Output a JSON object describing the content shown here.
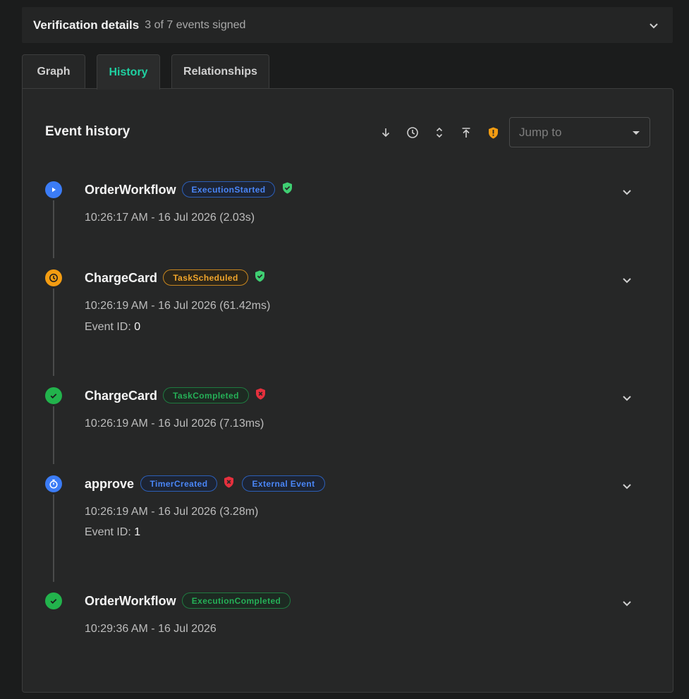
{
  "verification": {
    "title": "Verification details",
    "subtitle": "3 of 7 events signed"
  },
  "tabs": [
    {
      "label": "Graph",
      "active": false
    },
    {
      "label": "History",
      "active": true
    },
    {
      "label": "Relationships",
      "active": false
    }
  ],
  "panel": {
    "title": "Event history",
    "toolbar": [
      "sort-descending-icon",
      "clock-icon",
      "expand-collapse-icon",
      "scroll-to-top-icon",
      "shield-warning-icon"
    ],
    "jump": {
      "placeholder": "Jump to",
      "value": ""
    }
  },
  "colors": {
    "accent": "#1fd1a2",
    "blue": "#3b7cf6",
    "orange": "#f39c12",
    "green": "#22b34c",
    "shield_ok": "#3fcf72",
    "shield_bad": "#e5303d",
    "shield_warn": "#f39c12"
  },
  "events": [
    {
      "name": "OrderWorkflow",
      "status_icon": "play-icon",
      "badge": "ExecutionStarted",
      "badge_color": "blue",
      "signed": "verified",
      "time": "10:26:17 AM - 16 Jul 2026  (2.03s)"
    },
    {
      "name": "ChargeCard",
      "status_icon": "clock-icon",
      "badge": "TaskScheduled",
      "badge_color": "orange",
      "signed": "verified",
      "time": "10:26:19 AM - 16 Jul 2026  (61.42ms)",
      "event_id_label": "Event ID:",
      "event_id": "0"
    },
    {
      "name": "ChargeCard",
      "status_icon": "check-icon",
      "badge": "TaskCompleted",
      "badge_color": "green",
      "signed": "failed",
      "time": "10:26:19 AM - 16 Jul 2026  (7.13ms)"
    },
    {
      "name": "approve",
      "status_icon": "timer-icon",
      "badge": "TimerCreated",
      "badge_color": "blue",
      "signed": "failed",
      "extra_badge": "External Event",
      "time": "10:26:19 AM - 16 Jul 2026  (3.28m)",
      "event_id_label": "Event ID:",
      "event_id": "1"
    },
    {
      "name": "OrderWorkflow",
      "status_icon": "check-icon",
      "badge": "ExecutionCompleted",
      "badge_color": "green",
      "signed": "none",
      "time": "10:29:36 AM - 16 Jul 2026"
    }
  ]
}
